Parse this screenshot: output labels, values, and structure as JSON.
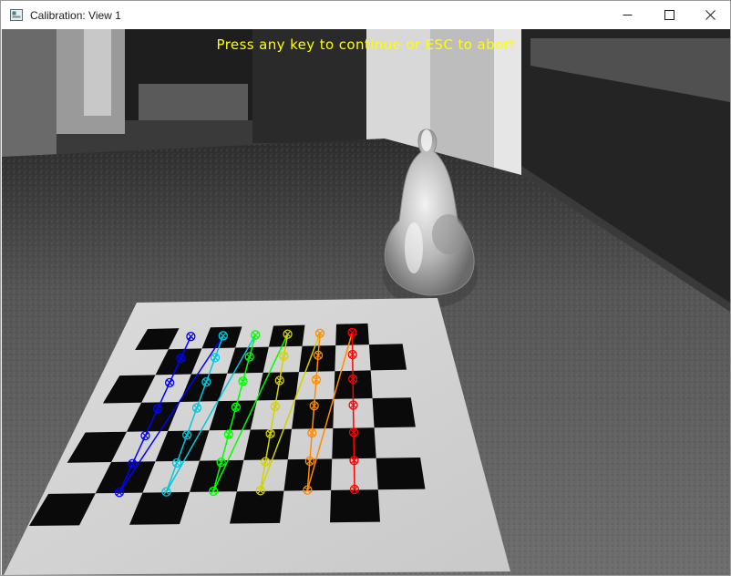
{
  "window": {
    "title": "Calibration: View 1",
    "controls": {
      "minimize": "minimize-icon",
      "maximize": "maximize-icon",
      "close": "close-icon"
    }
  },
  "image": {
    "overlay_message": "Press any key to continue or ESC to abort",
    "overlay_color": "#ffff00",
    "chessboard": {
      "inner_corners_cols": 6,
      "inner_corners_rows": 7,
      "column_colors": [
        "#0000ff",
        "#00c8dc",
        "#00ff00",
        "#d2d200",
        "#ff8c00",
        "#ff0000"
      ]
    }
  }
}
